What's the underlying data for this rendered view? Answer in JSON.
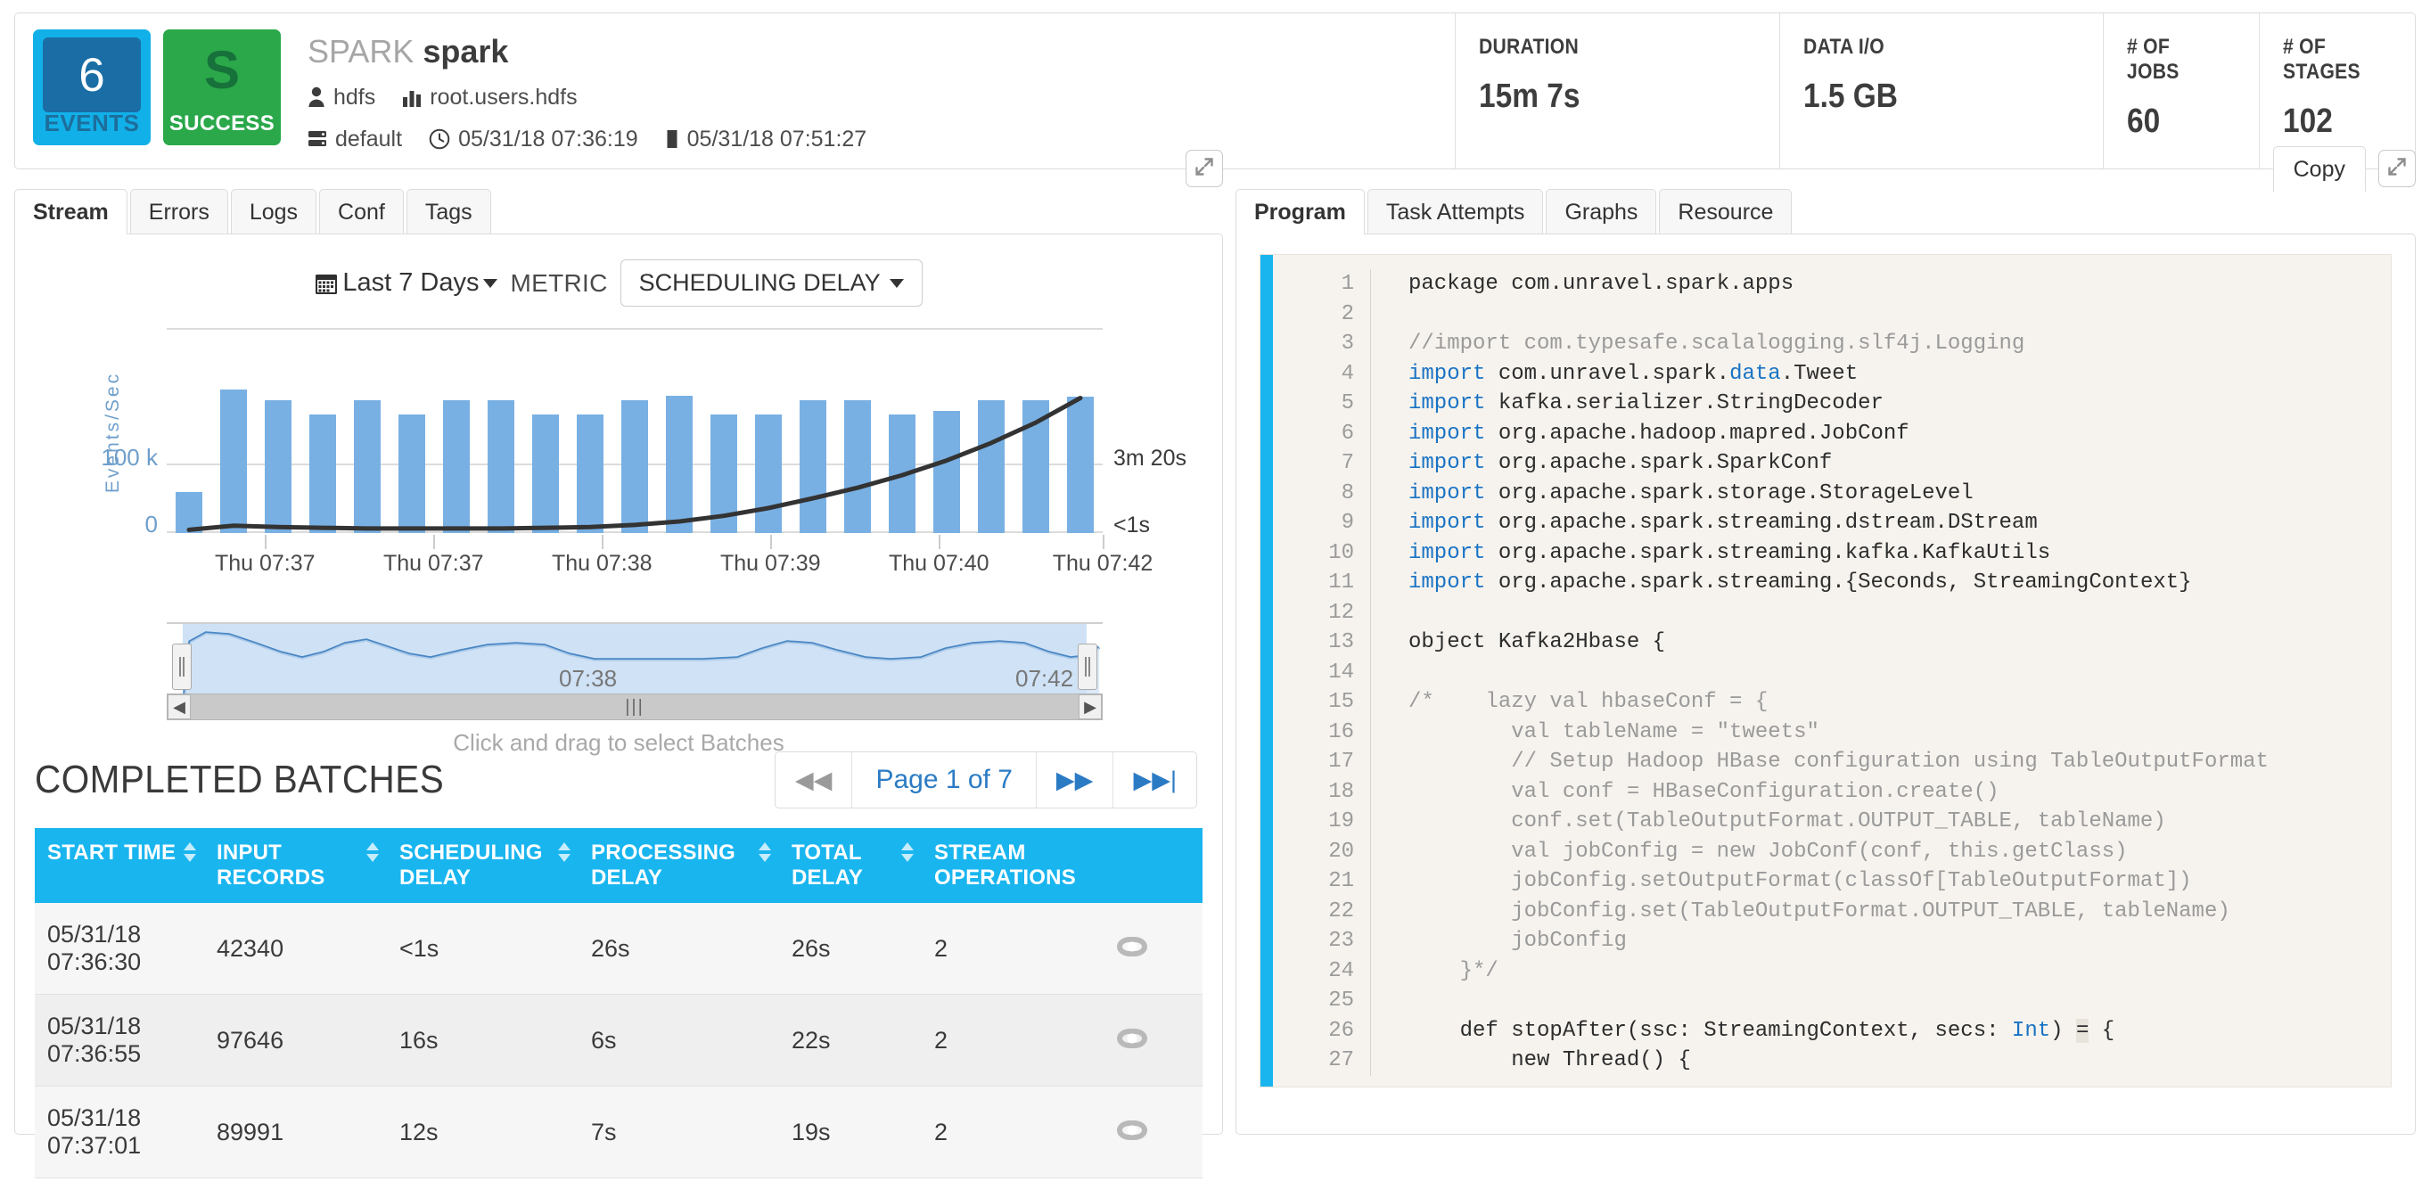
{
  "header": {
    "events_count": "6",
    "events_label": "EVENTS",
    "status_letter": "S",
    "status_label": "SUCCESS",
    "app_kind": "SPARK",
    "app_name": "spark",
    "user": "hdfs",
    "queue": "root.users.hdfs",
    "cluster": "default",
    "start_time": "05/31/18 07:36:19",
    "end_time": "05/31/18 07:51:27",
    "metrics": [
      {
        "label": "DURATION",
        "value": "15m 7s"
      },
      {
        "label": "DATA I/O",
        "value": "1.5 GB"
      },
      {
        "label": "# OF JOBS",
        "value": "60"
      },
      {
        "label": "# OF STAGES",
        "value": "102"
      }
    ]
  },
  "left_panel": {
    "tabs": [
      {
        "label": "Stream",
        "active": true
      },
      {
        "label": "Errors",
        "active": false
      },
      {
        "label": "Logs",
        "active": false
      },
      {
        "label": "Conf",
        "active": false
      },
      {
        "label": "Tags",
        "active": false
      }
    ],
    "controls": {
      "date_range": "Last 7 Days",
      "metric_word": "METRIC",
      "metric_selected": "SCHEDULING DELAY"
    },
    "navigator": {
      "left_label": "07:38",
      "right_label": "07:42"
    },
    "hint": "Click and drag to select Batches",
    "batches_title": "COMPLETED BATCHES",
    "pagination": {
      "first_label": "◀◀",
      "page_text": "Page 1 of 7",
      "next_label": "▶▶",
      "last_label": "▶▶|"
    },
    "table": {
      "columns": [
        "START TIME",
        "INPUT RECORDS",
        "SCHEDULING DELAY",
        "PROCESSING DELAY",
        "TOTAL DELAY",
        "STREAM OPERATIONS"
      ],
      "rows": [
        {
          "start_time_date": "05/31/18",
          "start_time_clock": "07:36:30",
          "input_records": "42340",
          "scheduling_delay": "<1s",
          "processing_delay": "26s",
          "total_delay": "26s",
          "stream_operations": "2"
        },
        {
          "start_time_date": "05/31/18",
          "start_time_clock": "07:36:55",
          "input_records": "97646",
          "scheduling_delay": "16s",
          "processing_delay": "6s",
          "total_delay": "22s",
          "stream_operations": "2"
        },
        {
          "start_time_date": "05/31/18",
          "start_time_clock": "07:37:01",
          "input_records": "89991",
          "scheduling_delay": "12s",
          "processing_delay": "7s",
          "total_delay": "19s",
          "stream_operations": "2"
        }
      ]
    }
  },
  "right_panel": {
    "tabs": [
      {
        "label": "Program",
        "active": true
      },
      {
        "label": "Task Attempts",
        "active": false
      },
      {
        "label": "Graphs",
        "active": false
      },
      {
        "label": "Resource",
        "active": false
      }
    ],
    "copy_label": "Copy",
    "code_lines": [
      {
        "n": "1",
        "tokens": [
          {
            "t": "package com",
            "c": ""
          },
          {
            "t": ".",
            "c": "p"
          },
          {
            "t": "unravel",
            "c": ""
          },
          {
            "t": ".",
            "c": "p"
          },
          {
            "t": "spark",
            "c": ""
          },
          {
            "t": ".",
            "c": "p"
          },
          {
            "t": "apps",
            "c": ""
          }
        ]
      },
      {
        "n": "2",
        "tokens": []
      },
      {
        "n": "3",
        "tokens": [
          {
            "t": "//import com.typesafe.scalalogging.slf4j.Logging",
            "c": "cm"
          }
        ]
      },
      {
        "n": "4",
        "tokens": [
          {
            "t": "import",
            "c": "kw"
          },
          {
            "t": " com.unravel.spark.",
            "c": ""
          },
          {
            "t": "data",
            "c": "kw"
          },
          {
            "t": ".Tweet",
            "c": ""
          }
        ]
      },
      {
        "n": "5",
        "tokens": [
          {
            "t": "import",
            "c": "kw"
          },
          {
            "t": " kafka.serializer.StringDecoder",
            "c": ""
          }
        ]
      },
      {
        "n": "6",
        "tokens": [
          {
            "t": "import",
            "c": "kw"
          },
          {
            "t": " org.apache.hadoop.mapred.JobConf",
            "c": ""
          }
        ]
      },
      {
        "n": "7",
        "tokens": [
          {
            "t": "import",
            "c": "kw"
          },
          {
            "t": " org.apache.spark.SparkConf",
            "c": ""
          }
        ]
      },
      {
        "n": "8",
        "tokens": [
          {
            "t": "import",
            "c": "kw"
          },
          {
            "t": " org.apache.spark.storage.StorageLevel",
            "c": ""
          }
        ]
      },
      {
        "n": "9",
        "tokens": [
          {
            "t": "import",
            "c": "kw"
          },
          {
            "t": " org.apache.spark.streaming.dstream.DStream",
            "c": ""
          }
        ]
      },
      {
        "n": "10",
        "tokens": [
          {
            "t": "import",
            "c": "kw"
          },
          {
            "t": " org.apache.spark.streaming.kafka.KafkaUtils",
            "c": ""
          }
        ]
      },
      {
        "n": "11",
        "tokens": [
          {
            "t": "import",
            "c": "kw"
          },
          {
            "t": " org.apache.spark.streaming.{Seconds, StreamingContext}",
            "c": ""
          }
        ]
      },
      {
        "n": "12",
        "tokens": []
      },
      {
        "n": "13",
        "tokens": [
          {
            "t": "object Kafka2Hbase {",
            "c": ""
          }
        ]
      },
      {
        "n": "14",
        "tokens": []
      },
      {
        "n": "15",
        "tokens": [
          {
            "t": "/*    lazy val hbaseConf = {",
            "c": "cm"
          }
        ]
      },
      {
        "n": "16",
        "tokens": [
          {
            "t": "        val tableName = \"tweets\"",
            "c": "cm"
          }
        ]
      },
      {
        "n": "17",
        "tokens": [
          {
            "t": "        // Setup Hadoop HBase configuration using TableOutputFormat",
            "c": "cm"
          }
        ]
      },
      {
        "n": "18",
        "tokens": [
          {
            "t": "        val conf = HBaseConfiguration.create()",
            "c": "cm"
          }
        ]
      },
      {
        "n": "19",
        "tokens": [
          {
            "t": "        conf.set(TableOutputFormat.OUTPUT_TABLE, tableName)",
            "c": "cm"
          }
        ]
      },
      {
        "n": "20",
        "tokens": [
          {
            "t": "        val jobConfig = new JobConf(conf, this.getClass)",
            "c": "cm"
          }
        ]
      },
      {
        "n": "21",
        "tokens": [
          {
            "t": "        jobConfig.setOutputFormat(classOf[TableOutputFormat])",
            "c": "cm"
          }
        ]
      },
      {
        "n": "22",
        "tokens": [
          {
            "t": "        jobConfig.set(TableOutputFormat.OUTPUT_TABLE, tableName)",
            "c": "cm"
          }
        ]
      },
      {
        "n": "23",
        "tokens": [
          {
            "t": "        jobConfig",
            "c": "cm"
          }
        ]
      },
      {
        "n": "24",
        "tokens": [
          {
            "t": "    }*/",
            "c": "cm"
          }
        ]
      },
      {
        "n": "25",
        "tokens": []
      },
      {
        "n": "26",
        "tokens": [
          {
            "t": "    def stopAfter(ssc: StreamingContext, secs: ",
            "c": ""
          },
          {
            "t": "Int",
            "c": "kw"
          },
          {
            "t": ") ",
            "c": ""
          },
          {
            "t": "=",
            "c": "hl"
          },
          {
            "t": " {",
            "c": ""
          }
        ]
      },
      {
        "n": "27",
        "tokens": [
          {
            "t": "        new Thread() {",
            "c": ""
          }
        ]
      }
    ]
  },
  "chart_data": {
    "type": "bar",
    "title": "",
    "ylabel": "Events/Sec",
    "yticks": [
      "100 k",
      "0"
    ],
    "right_axis_ticks": [
      "3m 20s",
      "<1s"
    ],
    "xlabel": "",
    "xtick_labels": [
      "Thu 07:37",
      "Thu 07:37",
      "Thu 07:38",
      "Thu 07:39",
      "Thu 07:40",
      "Thu 07:42"
    ],
    "ylim": [
      0,
      130000
    ],
    "grid": true,
    "legend": "none",
    "series": [
      {
        "name": "Events/Sec",
        "type": "bar",
        "color": "#79b0e3",
        "values": [
          26000,
          92000,
          85000,
          76000,
          85000,
          76000,
          85000,
          85000,
          76000,
          76000,
          85000,
          88000,
          76000,
          76000,
          85000,
          85000,
          76000,
          78000,
          85000,
          85000,
          87000
        ]
      },
      {
        "name": "Scheduling Delay",
        "type": "line",
        "color": "#333333",
        "values": [
          2,
          8,
          6,
          5,
          4,
          4,
          4,
          4,
          5,
          6,
          9,
          14,
          22,
          33,
          47,
          62,
          80,
          101,
          126,
          155,
          190
        ]
      }
    ]
  }
}
